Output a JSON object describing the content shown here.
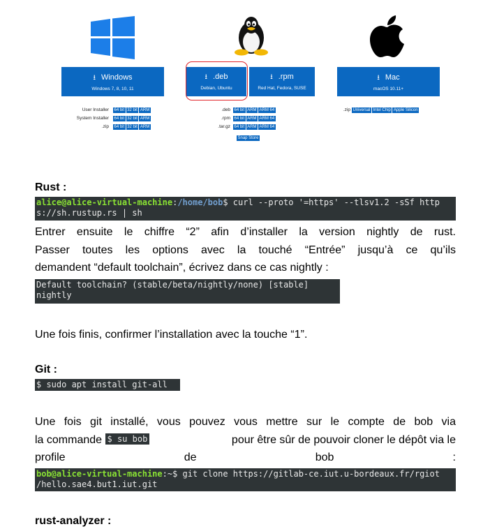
{
  "downloads": {
    "windows": {
      "label": "Windows",
      "sub": "Windows 7, 8, 10, 11",
      "rows": [
        {
          "label": "User Installer",
          "badges": [
            "64 bit",
            "32 bit",
            "ARM"
          ]
        },
        {
          "label": "System Installer",
          "badges": [
            "64 bit",
            "32 bit",
            "ARM"
          ]
        },
        {
          "label": ".zip",
          "badges": [
            "64 bit",
            "32 bit",
            "ARM"
          ]
        }
      ]
    },
    "deb": {
      "label": ".deb",
      "sub": "Debian, Ubuntu"
    },
    "rpm": {
      "label": ".rpm",
      "sub": "Red Hat, Fedora, SUSE"
    },
    "linux_rows": [
      {
        "label": ".deb",
        "badges": [
          "64 bit",
          "ARM",
          "ARM 64"
        ]
      },
      {
        "label": ".rpm",
        "badges": [
          "64 bit",
          "ARM",
          "ARM 64"
        ]
      },
      {
        "label": ".tar.gz",
        "badges": [
          "64 bit",
          "ARM",
          "ARM 64"
        ]
      }
    ],
    "snap": "Snap Store",
    "mac": {
      "label": "Mac",
      "sub": "macOS 10.11+",
      "rows": [
        {
          "label": ".zip",
          "badges": [
            "Universal",
            "Intel Chip",
            "Apple Silicon"
          ]
        }
      ]
    },
    "arrow": "⭳",
    "brand_color": "#0b68c1",
    "highlight_color": "#e0242a"
  },
  "rust": {
    "heading": "Rust :",
    "cmd_user": "alice@alice-virtual-machine",
    "cmd_sep": ":",
    "cmd_path": "/home/bob",
    "cmd_text": "$ curl --proto '=https' --tlsv1.2 -sSf http",
    "cmd_line2": "s://sh.rustup.rs | sh",
    "para_line1": "Entrer ensuite le chiffre “2” afin d’installer la version nightly de rust.",
    "para_line2": "Passer toutes les options avec la touché “Entrée” jusqu’à ce qu’ils",
    "para_line3": "demandent “default toolchain”, écrivez dans ce cas nightly :",
    "toolchain_line1": "Default toolchain? (stable/beta/nightly/none) [stable]",
    "toolchain_line2": "nightly",
    "confirm": "Une fois finis, confirmer l’installation avec la touche “1”."
  },
  "git": {
    "heading": "Git :",
    "cmd": "$ sudo apt install git-all",
    "para_line1": "Une fois git installé, vous pouvez vous mettre sur le compte de bob via",
    "para_line2_a": "la commande",
    "inline_cmd": "$ su bob",
    "para_line2_b": "pour être sûr de pouvoir cloner le dépôt via le",
    "para_line3_w1": "profile",
    "para_line3_w2": "de",
    "para_line3_w3": "bob",
    "para_line3_w4": ":",
    "clone_user": "bob@alice-virtual-machine",
    "clone_sep": ":~",
    "clone_text": "$ git clone https://gitlab-ce.iut.u-bordeaux.fr/rgiot",
    "clone_line2": "/hello.sae4.but1.iut.git"
  },
  "analyzer": {
    "heading": "rust-analyzer :"
  }
}
